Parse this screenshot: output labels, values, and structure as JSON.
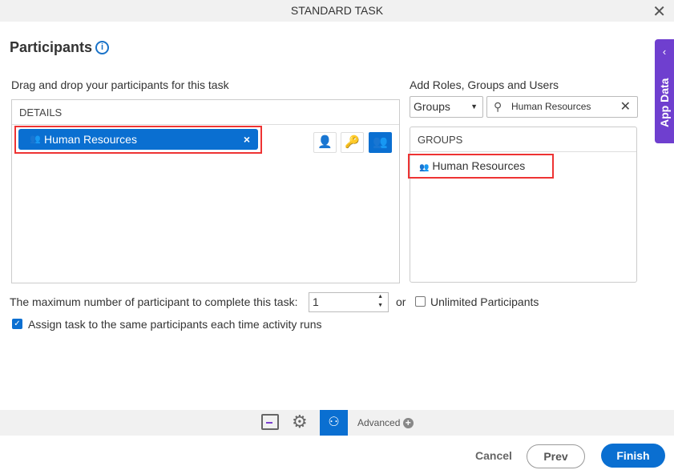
{
  "window": {
    "title": "STANDARD TASK"
  },
  "page": {
    "title": "Participants"
  },
  "left": {
    "instruction": "Drag and drop your participants for this task",
    "details_header": "DETAILS",
    "chip_label": "Human Resources"
  },
  "right": {
    "instruction": "Add Roles, Groups and Users",
    "type_select": "Groups",
    "search_value": "Human Resources",
    "groups_header": "GROUPS",
    "result": "Human Resources"
  },
  "max": {
    "label": "The maximum number of participant to complete this task:",
    "value": "1",
    "or": "or",
    "unlimited_label": "Unlimited Participants",
    "unlimited_checked": false
  },
  "assign": {
    "label": "Assign task to the same participants each time activity runs",
    "checked": true
  },
  "app_data": {
    "label": "App Data"
  },
  "toolbar": {
    "advanced": "Advanced"
  },
  "footer": {
    "cancel": "Cancel",
    "prev": "Prev",
    "finish": "Finish"
  },
  "colors": {
    "primary": "#0a6fd1",
    "app_data": "#6f3fcf",
    "highlight": "#e33333"
  }
}
